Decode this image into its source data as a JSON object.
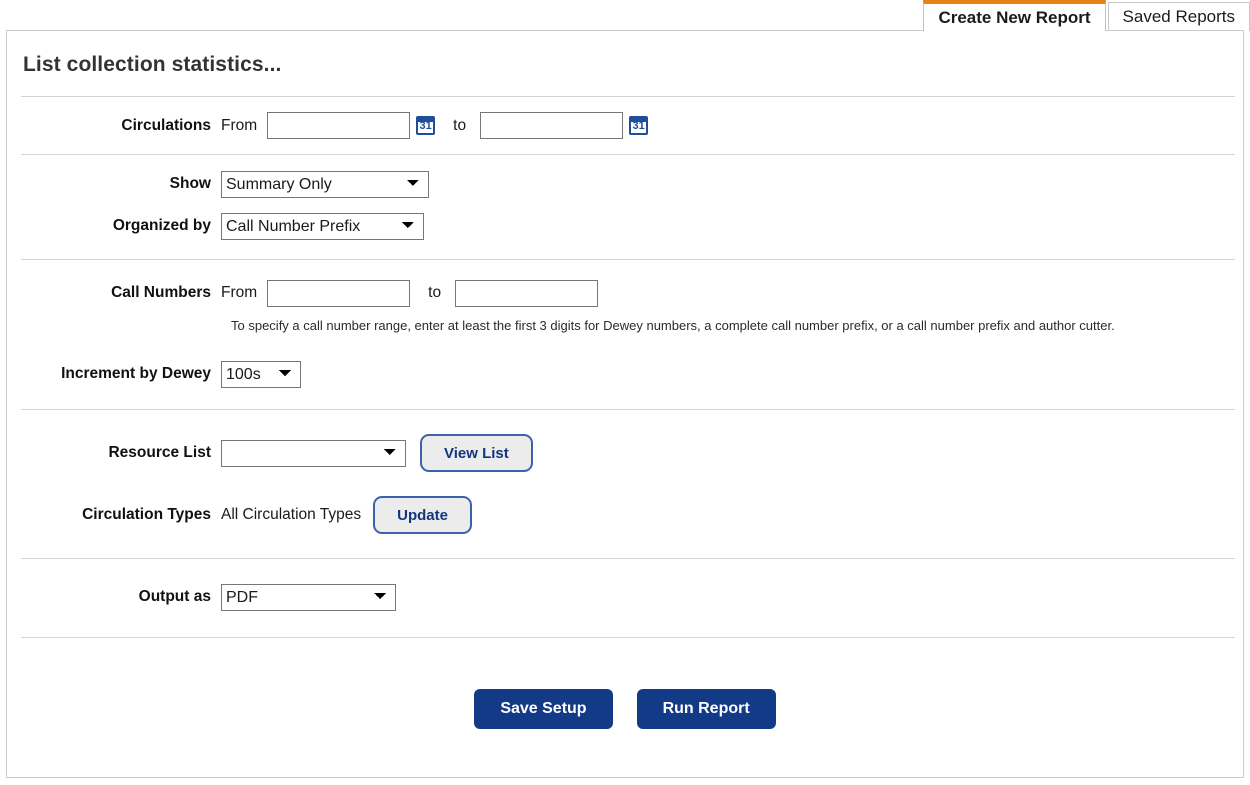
{
  "tabs": [
    {
      "label": "Create New Report",
      "active": true
    },
    {
      "label": "Saved Reports",
      "active": false
    }
  ],
  "page": {
    "title": "List collection statistics..."
  },
  "circulations": {
    "label": "Circulations",
    "from_label": "From",
    "to_label": "to",
    "from_value": "",
    "to_value": "",
    "from_placeholder": "",
    "to_placeholder": "",
    "calendar_icon_text": "31"
  },
  "show": {
    "label": "Show",
    "value": "Summary Only",
    "options": [
      "Summary Only"
    ]
  },
  "organized_by": {
    "label": "Organized by",
    "value": "Call Number Prefix",
    "options": [
      "Call Number Prefix"
    ]
  },
  "call_numbers": {
    "label": "Call Numbers",
    "from_label": "From",
    "to_label": "to",
    "from_value": "",
    "to_value": "",
    "help": "To specify a call number range, enter at least the first 3 digits for Dewey numbers, a complete call number prefix, or a call number prefix and author cutter."
  },
  "increment_by_dewey": {
    "label": "Increment by Dewey",
    "value": "100s",
    "options": [
      "100s"
    ]
  },
  "resource_list": {
    "label": "Resource List",
    "value": "",
    "options": [
      ""
    ],
    "button_label": "View List"
  },
  "circulation_types": {
    "label": "Circulation Types",
    "value": "All Circulation Types",
    "button_label": "Update"
  },
  "output_as": {
    "label": "Output as",
    "value": "PDF",
    "options": [
      "PDF"
    ]
  },
  "actions": {
    "save_label": "Save Setup",
    "run_label": "Run Report"
  },
  "colors": {
    "accent_orange": "#e8801a",
    "button_navy": "#123a86",
    "outline_blue": "#3b63ad",
    "calendar_blue": "#1f4e9c"
  }
}
